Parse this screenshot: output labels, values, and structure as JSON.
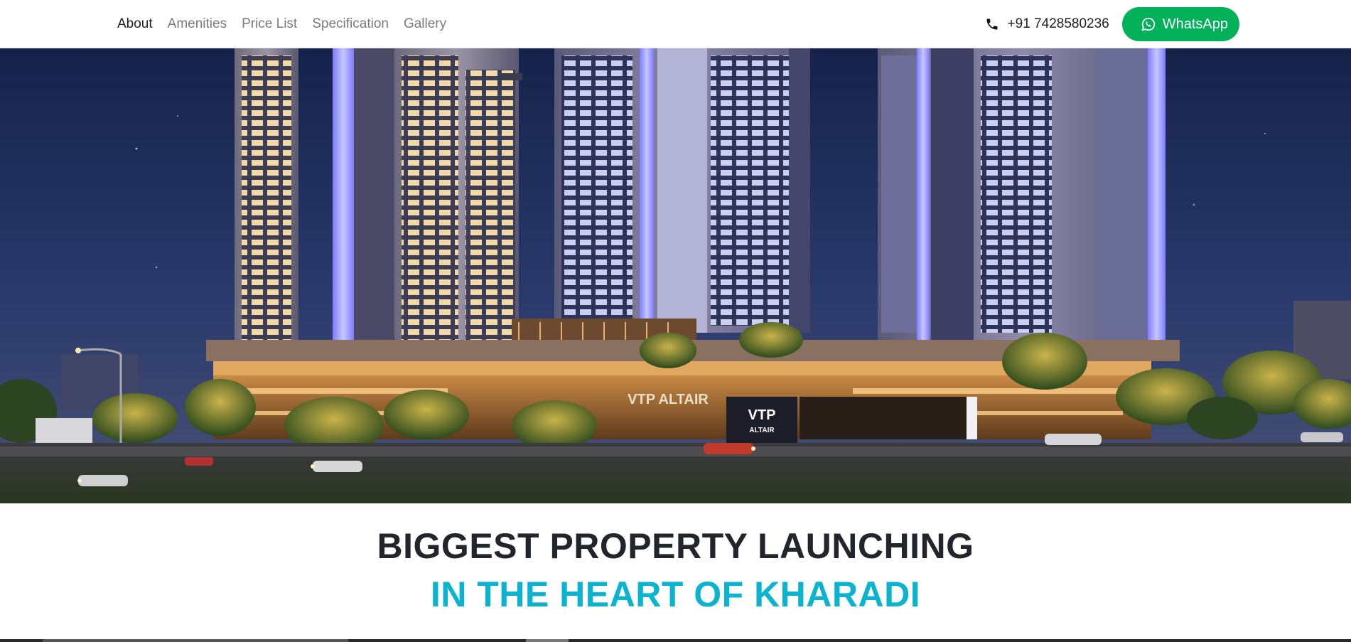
{
  "nav": {
    "links": [
      "About",
      "Amenities",
      "Price List",
      "Specification",
      "Gallery"
    ],
    "active_index": 0
  },
  "contact": {
    "phone_icon": "phone-icon",
    "phone": "+91 7428580236",
    "whatsapp_icon": "whatsapp-icon",
    "whatsapp_label": "WhatsApp"
  },
  "hero": {
    "image_desc_icon": "building-render-image",
    "sign_text_1": "VTP",
    "sign_text_2": "ALTAIR",
    "facade_text": "VTP ALTAIR"
  },
  "headline": {
    "line1": "BIGGEST PROPERTY LAUNCHING",
    "line2": "IN THE HEART OF KHARADI"
  },
  "colors": {
    "whatsapp_green": "#00b15a",
    "headline_dark": "#22252b",
    "headline_cyan": "#0ab3cf"
  }
}
